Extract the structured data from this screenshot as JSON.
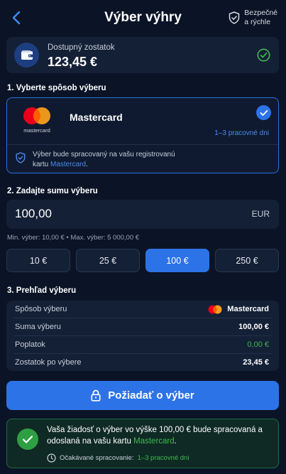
{
  "header": {
    "title": "Výber výhry",
    "secure_line1": "Bezpečné",
    "secure_line2": "a rýchle"
  },
  "balance": {
    "label": "Dostupný zostatok",
    "amount": "123,45 €"
  },
  "section1": {
    "title": "1. Vyberte spôsob výberu",
    "method_name": "Mastercard",
    "logo_text": "mastercard",
    "processing_days": "1–3 pracovné dni",
    "note_prefix": "Výber bude spracovaný na vašu registrovanú",
    "note_card_word": "kartu",
    "note_card_link": "Mastercard",
    "note_suffix": "."
  },
  "section2": {
    "title": "2. Zadajte sumu výberu",
    "amount_value": "100,00",
    "currency": "EUR",
    "limits": "Min. výber: 10,00 €  •  Max. výber: 5 000,00 €",
    "chips": [
      "10 €",
      "25 €",
      "100 €",
      "250 €"
    ],
    "active_chip": "100 €"
  },
  "section3": {
    "title": "3. Prehľad výberu",
    "rows": [
      {
        "label": "Spôsob výberu",
        "value": "Mastercard"
      },
      {
        "label": "Suma výberu",
        "value": "100,00 €"
      },
      {
        "label": "Poplatok",
        "value": "0,00 €"
      },
      {
        "label": "Zostatok po výbere",
        "value": "23,45 €"
      }
    ]
  },
  "submit": {
    "label": "Požiadať o výber"
  },
  "success": {
    "text_part1": "Vaša žiadosť o výber vo výške 100,00 € bude spracovaná a odoslaná na vašu kartu",
    "text_card": "Mastercard",
    "text_end": ".",
    "eta_label": "Očakávané spracovanie:",
    "eta_value": "1–3 pracovné dni"
  },
  "colors": {
    "background": "#0b1426",
    "accent": "#2d73e8",
    "success": "#3fb950",
    "card": "#142036"
  }
}
